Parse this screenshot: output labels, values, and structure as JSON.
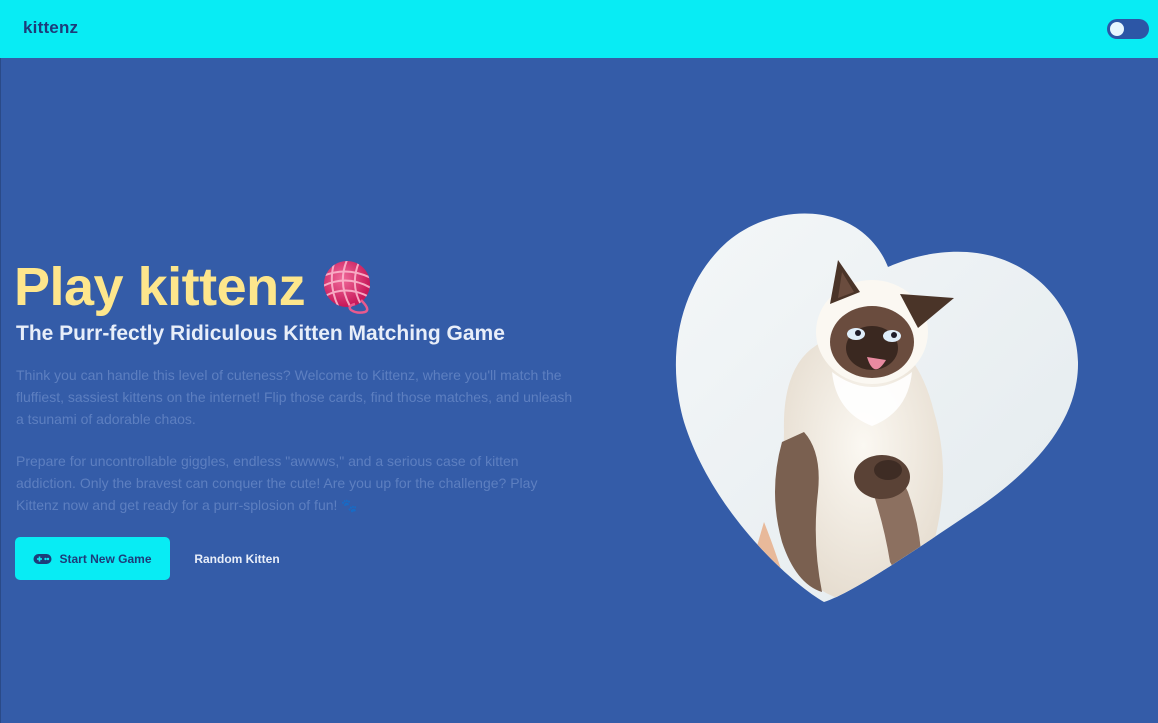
{
  "header": {
    "brand": "kittenz",
    "theme_toggle": {
      "state": "off"
    }
  },
  "hero": {
    "title": "Play kittenz",
    "title_icon": "yarn-ball-icon",
    "subtitle": "The Purr-fectly Ridiculous Kitten Matching Game",
    "paragraph_1": "Think you can handle this level of cuteness? Welcome to Kittenz, where you'll match the fluffiest, sassiest kittens on the internet! Flip those cards, find those matches, and unleash a tsunami of adorable chaos.",
    "paragraph_2": "Prepare for uncontrollable giggles, endless \"awwws,\" and a serious case of kitten addiction. Only the bravest can conquer the cute! Are you up for the challenge? Play Kittenz now and get ready for a purr-splosion of fun!",
    "paragraph_2_end_icon": "paw-icon",
    "paw_glyph": "🐾"
  },
  "actions": {
    "start_label": "Start New Game",
    "start_icon": "gamepad-icon",
    "random_label": "Random Kitten"
  },
  "image": {
    "subject": "heart-shaped kitten photo",
    "shape": "heart"
  },
  "colors": {
    "background": "#345ca8",
    "header": "#08ecf4",
    "title": "#fde68c",
    "brand_text": "#1d3c7a",
    "accent_button": "#08ecf4"
  }
}
